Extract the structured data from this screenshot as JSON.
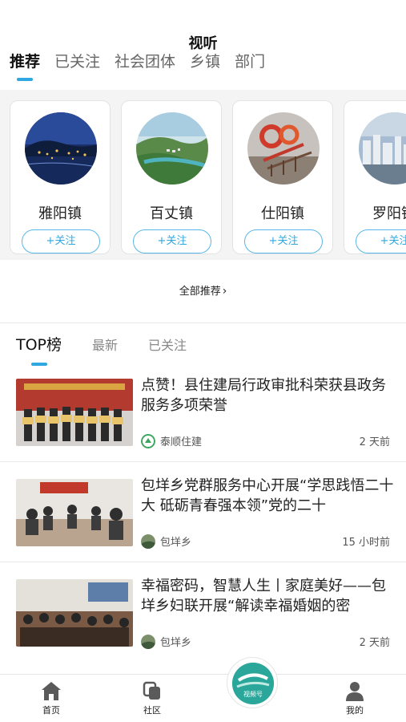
{
  "header": {
    "title": "视听"
  },
  "top_tabs": [
    {
      "label": "推荐",
      "active": true
    },
    {
      "label": "已关注",
      "active": false
    },
    {
      "label": "社会团体",
      "active": false
    },
    {
      "label": "乡镇",
      "active": false
    },
    {
      "label": "部门",
      "active": false
    }
  ],
  "recommend_cards": [
    {
      "name": "雅阳镇",
      "follow_label": "+关注"
    },
    {
      "name": "百丈镇",
      "follow_label": "+关注"
    },
    {
      "name": "仕阳镇",
      "follow_label": "+关注"
    },
    {
      "name": "罗阳镇",
      "follow_label": "+关注"
    }
  ],
  "all_recommend": {
    "label": "全部推荐"
  },
  "list_tabs": [
    {
      "label": "TOP榜",
      "active": true
    },
    {
      "label": "最新",
      "active": false
    },
    {
      "label": "已关注",
      "active": false
    }
  ],
  "news": [
    {
      "title": "点赞！县住建局行政审批科荣获县政务服务多项荣誉",
      "source": "泰顺住建",
      "time": "2 天前"
    },
    {
      "title": "包垟乡党群服务中心开展“学思践悟二十大 砥砺青春强本领”党的二十",
      "source": "包垟乡",
      "time": "15 小时前"
    },
    {
      "title": "幸福密码，智慧人生丨家庭美好——包垟乡妇联开展“解读幸福婚姻的密",
      "source": "包垟乡",
      "time": "2 天前"
    }
  ],
  "bottom_nav": {
    "home": "首页",
    "community": "社区",
    "center": "视频号",
    "mine": "我的"
  },
  "colors": {
    "accent": "#2fa7e0",
    "center_button": "#2aa79a"
  }
}
